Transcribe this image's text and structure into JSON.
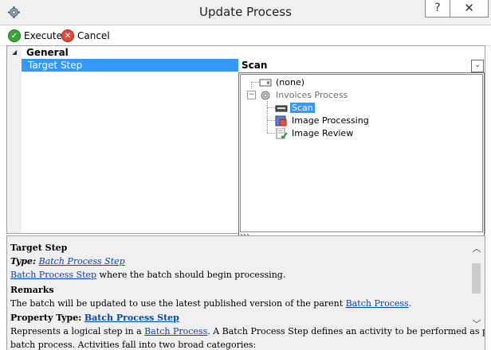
{
  "window": {
    "title": "Update Process",
    "help_label": "?",
    "close_label": "✕"
  },
  "toolbar": {
    "execute_label": "Execute",
    "cancel_label": "Cancel"
  },
  "grid": {
    "category": "General",
    "property_name": "Target Step",
    "property_value": "Scan"
  },
  "dropdown": {
    "nodes": [
      {
        "label": "(none)"
      },
      {
        "label": "Invoices Process"
      },
      {
        "label": "Scan"
      },
      {
        "label": "Image Processing"
      },
      {
        "label": "Image Review"
      }
    ]
  },
  "description": {
    "heading": "Target Step",
    "type_prefix": "Type:",
    "type_link": "Batch Process Step",
    "line1_link": "Batch Process Step",
    "line1_text": " where the batch should begin processing.",
    "remarks_heading": "Remarks",
    "remarks_text": "The batch will be updated to use the latest published version of the parent ",
    "remarks_link": "Batch Process",
    "remarks_end": ".",
    "property_type_prefix": "Property Type:",
    "property_type_link": "Batch Process Step",
    "last_text_start": "Represents a logical step in a ",
    "last_link": "Batch Process",
    "last_text_end": ". A Batch Process Step defines an activity to be performed as part of a",
    "cut_line": "batch process. Activities fall into two broad categories:"
  },
  "colors": {
    "selection": "#3399ff",
    "link": "#0645ad",
    "execute": "#3aa43a",
    "cancel": "#e04a3a"
  }
}
